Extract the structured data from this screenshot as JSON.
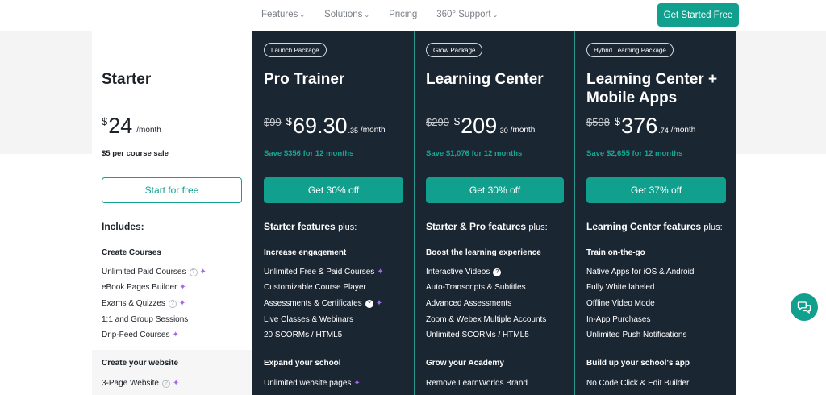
{
  "nav": {
    "items": [
      {
        "label": "Features",
        "chevron": true
      },
      {
        "label": "Solutions",
        "chevron": true
      },
      {
        "label": "Pricing",
        "chevron": false
      },
      {
        "label": "360° Support",
        "chevron": true
      }
    ],
    "cta_label": "Get Started Free"
  },
  "plans": {
    "starter": {
      "title": "Starter",
      "currency": "$",
      "price": "24",
      "period": "/month",
      "subline": "$5 per course sale",
      "button": "Start for free",
      "includes": "Includes:",
      "sections": [
        {
          "heading": "Create Courses",
          "features": [
            "Unlimited Paid Courses",
            "eBook Pages Builder",
            "Exams & Quizzes",
            "1:1 and Group Sessions",
            "Drip-Feed Courses"
          ]
        },
        {
          "heading": "Create your website",
          "features": [
            "3-Page Website"
          ]
        }
      ]
    },
    "pro": {
      "tag": "Launch Package",
      "title": "Pro Trainer",
      "old_price": "$99",
      "currency": "$",
      "price": "69.30",
      "cents": ".35",
      "period": "/month",
      "save": "Save $356 for 12 months",
      "button": "Get 30% off",
      "includes_bold": "Starter features",
      "includes_plus": "plus:",
      "sections": [
        {
          "heading": "Increase engagement",
          "features": [
            "Unlimited Free & Paid Courses",
            "Customizable Course Player",
            "Assessments & Certificates",
            "Live Classes & Webinars",
            "20 SCORMs / HTML5"
          ]
        },
        {
          "heading": "Expand your school",
          "features": [
            "Unlimited website pages"
          ]
        }
      ]
    },
    "center": {
      "tag": "Grow Package",
      "title": "Learning Center",
      "old_price": "$299",
      "currency": "$",
      "price": "209",
      "cents": ".30",
      "period": "/month",
      "save": "Save $1,076 for 12 months",
      "button": "Get 30% off",
      "includes_bold": "Starter & Pro features",
      "includes_plus": "plus:",
      "sections": [
        {
          "heading": "Boost the learning experience",
          "features": [
            "Interactive Videos",
            "Auto-Transcripts & Subtitles",
            "Advanced Assessments",
            "Zoom & Webex Multiple Accounts",
            "Unlimited SCORMs / HTML5"
          ]
        },
        {
          "heading": "Grow your Academy",
          "features": [
            "Remove LearnWorlds Brand"
          ]
        }
      ]
    },
    "mobile": {
      "tag": "Hybrid Learning Package",
      "title_line1": "Learning Center +",
      "title_line2": "Mobile Apps",
      "old_price": "$598",
      "currency": "$",
      "price": "376",
      "cents": ".74",
      "period": "/month",
      "save": "Save $2,655 for 12 months",
      "button": "Get 37% off",
      "includes_bold": "Learning Center features",
      "includes_plus": "plus:",
      "sections": [
        {
          "heading": "Train on-the-go",
          "features": [
            "Native Apps for iOS & Android",
            "Fully White labeled",
            "Offline Video Mode",
            "In-App Purchases",
            "Unlimited Push Notifications"
          ]
        },
        {
          "heading": "Build up your school's app",
          "features": [
            "No Code Click & Edit Builder"
          ]
        }
      ]
    }
  },
  "icons": {
    "help": "?",
    "sparkle": "✦",
    "chat": "chat-bubbles-icon"
  },
  "colors": {
    "accent": "#12a08e",
    "dark_panel": "#1b2633",
    "sparkle": "#a26be2",
    "save_text": "#19a592"
  }
}
